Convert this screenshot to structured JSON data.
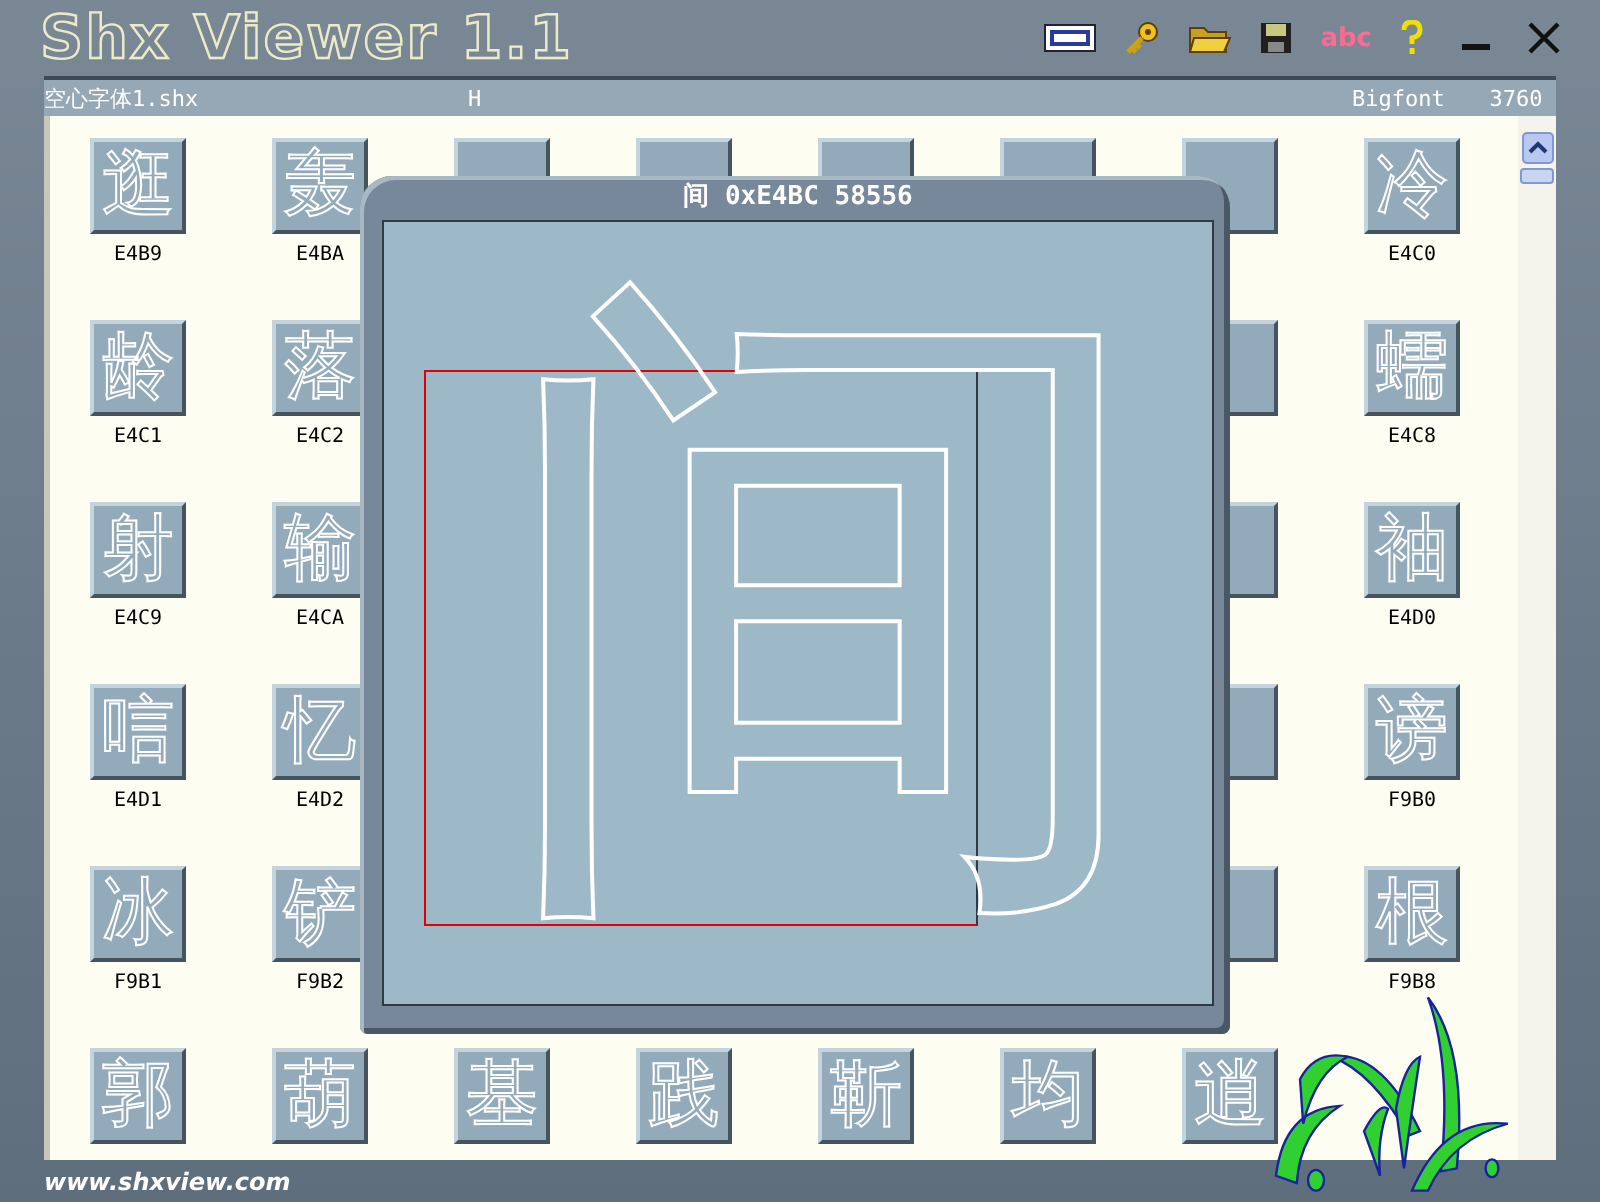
{
  "window": {
    "title": "Shx Viewer 1.1"
  },
  "toolbar": {
    "abc_label": "abc"
  },
  "header": {
    "file": "空心字体1.shx",
    "char": "H",
    "font_type": "Bigfont",
    "count": "3760"
  },
  "grid": [
    {
      "kind": "glyph",
      "char": "逛",
      "code": "E4B9"
    },
    {
      "kind": "glyph",
      "char": "轰",
      "code": "E4BA"
    },
    {
      "kind": "blank"
    },
    {
      "kind": "blank"
    },
    {
      "kind": "blank"
    },
    {
      "kind": "blank"
    },
    {
      "kind": "blank"
    },
    {
      "kind": "glyph",
      "char": "冷",
      "code": "E4C0"
    },
    {
      "kind": "glyph",
      "char": "龄",
      "code": "E4C1"
    },
    {
      "kind": "glyph",
      "char": "落",
      "code": "E4C2"
    },
    {
      "kind": "blank"
    },
    {
      "kind": "blank"
    },
    {
      "kind": "blank"
    },
    {
      "kind": "blank"
    },
    {
      "kind": "blank"
    },
    {
      "kind": "glyph",
      "char": "蠕",
      "code": "E4C8"
    },
    {
      "kind": "glyph",
      "char": "射",
      "code": "E4C9"
    },
    {
      "kind": "glyph",
      "char": "输",
      "code": "E4CA"
    },
    {
      "kind": "blank"
    },
    {
      "kind": "blank"
    },
    {
      "kind": "blank"
    },
    {
      "kind": "blank"
    },
    {
      "kind": "blank"
    },
    {
      "kind": "glyph",
      "char": "袖",
      "code": "E4D0"
    },
    {
      "kind": "glyph",
      "char": "唁",
      "code": "E4D1"
    },
    {
      "kind": "glyph",
      "char": "忆",
      "code": "E4D2"
    },
    {
      "kind": "blank"
    },
    {
      "kind": "blank"
    },
    {
      "kind": "blank"
    },
    {
      "kind": "blank"
    },
    {
      "kind": "blank"
    },
    {
      "kind": "glyph",
      "char": "谤",
      "code": "F9B0"
    },
    {
      "kind": "glyph",
      "char": "冰",
      "code": "F9B1"
    },
    {
      "kind": "glyph",
      "char": "铲",
      "code": "F9B2"
    },
    {
      "kind": "blank"
    },
    {
      "kind": "blank"
    },
    {
      "kind": "blank"
    },
    {
      "kind": "blank"
    },
    {
      "kind": "blank"
    },
    {
      "kind": "glyph",
      "char": "根",
      "code": "F9B8"
    },
    {
      "kind": "glyph",
      "char": "郭"
    },
    {
      "kind": "glyph",
      "char": "葫"
    },
    {
      "kind": "glyph",
      "char": "基"
    },
    {
      "kind": "glyph",
      "char": "践"
    },
    {
      "kind": "glyph",
      "char": "靳"
    },
    {
      "kind": "glyph",
      "char": "均"
    },
    {
      "kind": "glyph",
      "char": "逍"
    }
  ],
  "dialog": {
    "title": "间 0xE4BC 58556",
    "glyph": "间"
  },
  "footer": "www.shxview.com"
}
